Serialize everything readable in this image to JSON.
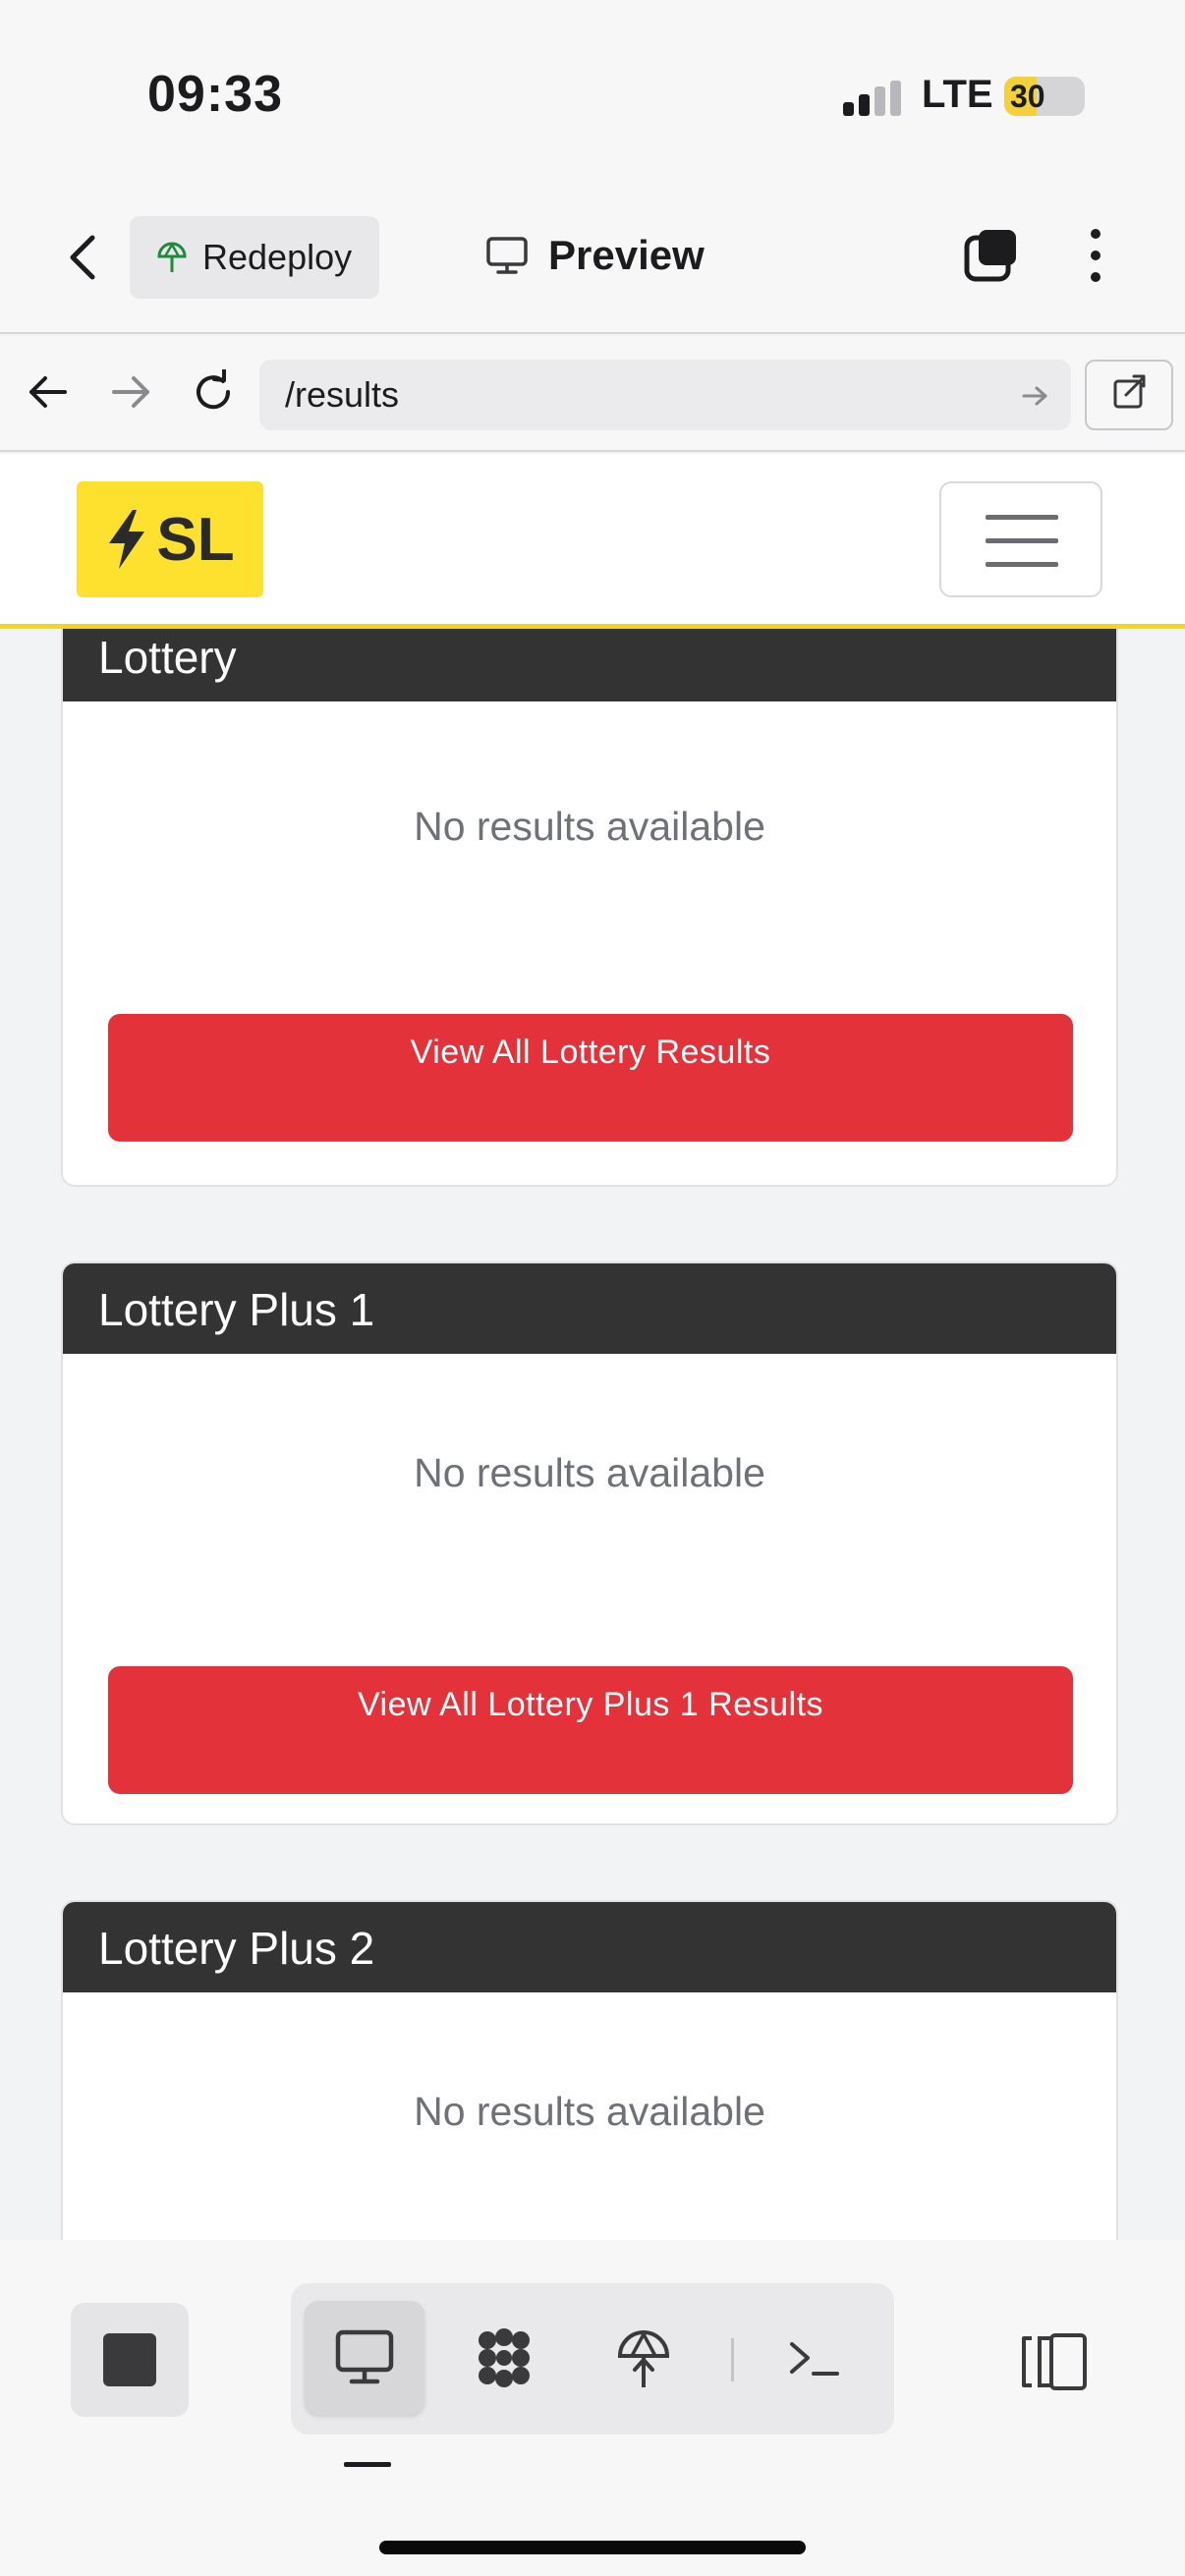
{
  "status_bar": {
    "time": "09:33",
    "network": "LTE",
    "battery": "30"
  },
  "app_header": {
    "redeploy_label": "Redeploy",
    "preview_label": "Preview"
  },
  "browser": {
    "url": "/results"
  },
  "site": {
    "logo_text": "SL"
  },
  "cards": [
    {
      "title": "Lottery",
      "empty_text": "No results available",
      "button_label": "View All Lottery Results"
    },
    {
      "title": "Lottery Plus 1",
      "empty_text": "No results available",
      "button_label": "View All Lottery Plus 1 Results"
    },
    {
      "title": "Lottery Plus 2",
      "empty_text": "No results available"
    }
  ],
  "toolbar": {
    "items": [
      "stop-icon",
      "desktop-icon",
      "nodes-icon",
      "deploy-icon",
      "terminal-icon",
      "split-view-icon"
    ],
    "active": "desktop-icon"
  },
  "colors": {
    "brand_yellow": "#fde12e",
    "header_dark": "#333333",
    "button_red": "#e3323a"
  }
}
